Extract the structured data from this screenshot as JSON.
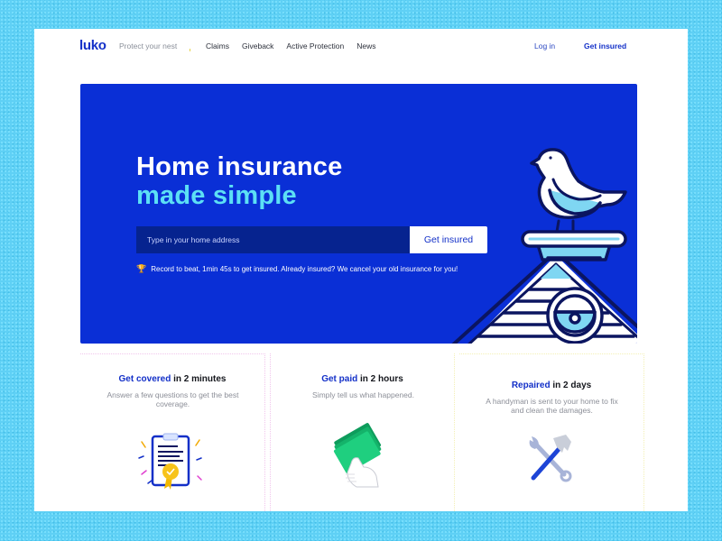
{
  "nav": {
    "logo": "luko",
    "tagline": "Protect your nest",
    "links": [
      "Claims",
      "Giveback",
      "Active Protection",
      "News"
    ],
    "login": "Log in",
    "get_insured": "Get insured"
  },
  "hero": {
    "title_line1": "Home insurance",
    "title_line2": "made simple",
    "search_placeholder": "Type in your home address",
    "search_value": "",
    "cta": "Get insured",
    "note_icon": "trophy-icon",
    "note": "Record to beat, 1min 45s to get insured. Already insured? We cancel your old insurance for you!",
    "illustration": "pigeon-on-roof-illustration"
  },
  "features": [
    {
      "highlight": "Get covered",
      "rest": " in 2 minutes",
      "description": "Answer a few questions to get the best coverage.",
      "icon": "certificate-clipboard-icon"
    },
    {
      "highlight": "Get paid",
      "rest": " in 2 hours",
      "description": "Simply tell us what happened.",
      "icon": "cash-in-hand-icon"
    },
    {
      "highlight": "Repaired",
      "rest": " in 2 days",
      "description": "A handyman is sent to your home to fix and clean the damages.",
      "icon": "wrench-hammer-icon"
    }
  ],
  "colors": {
    "brand_blue": "#0a2fd6",
    "accent_cyan": "#5ce0f5",
    "background_cyan": "#5fd0f5",
    "dark_navy": "#0b1560"
  }
}
